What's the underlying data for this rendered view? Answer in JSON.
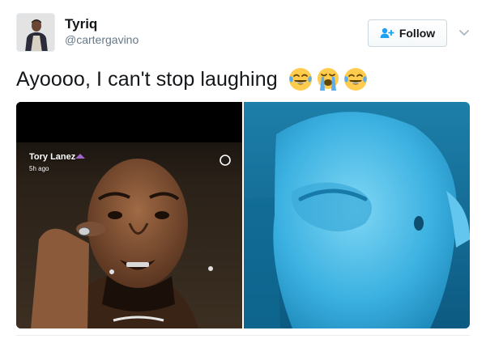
{
  "tweet": {
    "author_name": "Tyriq",
    "author_handle": "@cartergavino",
    "follow_label": "Follow",
    "text": "Ayoooo, I can't stop laughing",
    "emojis": [
      "face-with-tears-of-joy-icon",
      "loudly-crying-face-icon",
      "face-with-tears-of-joy-icon"
    ]
  },
  "media": {
    "story_name": "Tory Lanez",
    "story_time": "5h ago"
  },
  "colors": {
    "brand": "#1da1f2",
    "text": "#14171a",
    "muted": "#657786",
    "beluga": "#37b4e6"
  }
}
